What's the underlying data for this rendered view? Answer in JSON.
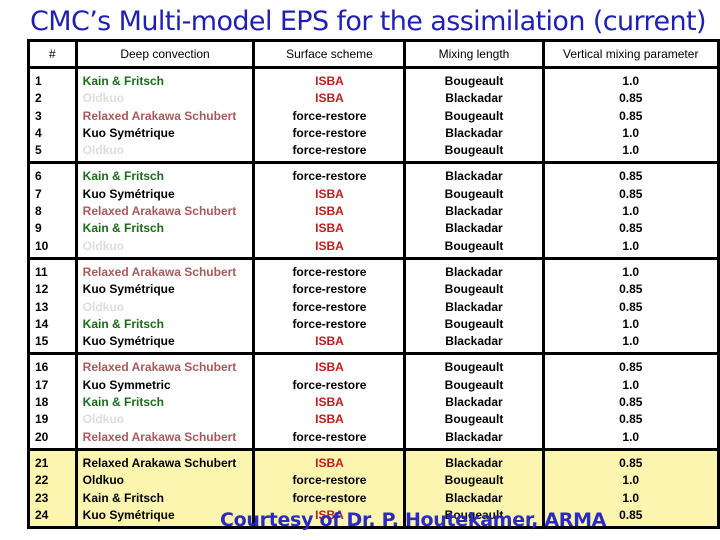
{
  "title": "CMC’s Multi-model EPS for the assimilation (current)",
  "table": {
    "headers": [
      "#",
      "Deep convection",
      "Surface scheme",
      "Mixing length",
      "Vertical mixing parameter"
    ],
    "groups": [
      {
        "highlight": false,
        "rows": [
          {
            "num": "1",
            "deep": " Kain & Fritsch",
            "deep_kind": "kain",
            "surface": "ISBA",
            "surface_kind": "isba",
            "mixing": "Bougeault",
            "vertical": "1.0"
          },
          {
            "num": "2",
            "deep": "Oldkuo",
            "deep_kind": "oldkuo",
            "surface": "ISBA",
            "surface_kind": "isba",
            "mixing": "Blackadar",
            "vertical": "0.85"
          },
          {
            "num": "3",
            "deep": "Relaxed Arakawa Schubert",
            "deep_kind": "ras",
            "surface": "force-restore",
            "surface_kind": "fr",
            "mixing": "Bougeault",
            "vertical": "0.85"
          },
          {
            "num": "4",
            "deep": "Kuo Symétrique",
            "deep_kind": "kuo",
            "surface": "force-restore",
            "surface_kind": "fr",
            "mixing": "Blackadar",
            "vertical": "1.0"
          },
          {
            "num": "5",
            "deep": "Oldkuo",
            "deep_kind": "oldkuo",
            "surface": "force-restore",
            "surface_kind": "fr",
            "mixing": "Bougeault",
            "vertical": "1.0"
          }
        ]
      },
      {
        "highlight": false,
        "rows": [
          {
            "num": "6",
            "deep": "Kain & Fritsch",
            "deep_kind": "kain",
            "surface": "force-restore",
            "surface_kind": "fr",
            "mixing": "Blackadar",
            "vertical": "0.85"
          },
          {
            "num": "7",
            "deep": "Kuo Symétrique",
            "deep_kind": "kuo",
            "surface": "ISBA",
            "surface_kind": "isba",
            "mixing": "Bougeault",
            "vertical": " 0.85"
          },
          {
            "num": "8",
            "deep": "Relaxed Arakawa Schubert",
            "deep_kind": "ras",
            "surface": "ISBA",
            "surface_kind": "isba",
            "mixing": "Blackadar",
            "vertical": "1.0"
          },
          {
            "num": "9",
            "deep": "Kain & Fritsch",
            "deep_kind": "kain",
            "surface": "ISBA",
            "surface_kind": "isba",
            "mixing": "Blackadar",
            "vertical": "0.85"
          },
          {
            "num": "10",
            "deep": "Oldkuo",
            "deep_kind": "oldkuo",
            "surface": "ISBA",
            "surface_kind": "isba",
            "mixing": "Bougeault",
            "vertical": "1.0"
          }
        ]
      },
      {
        "highlight": false,
        "rows": [
          {
            "num": "11",
            "deep": "Relaxed Arakawa Schubert",
            "deep_kind": "ras",
            "surface": "force-restore",
            "surface_kind": "fr",
            "mixing": "Blackadar",
            "vertical": "1.0"
          },
          {
            "num": "12",
            "deep": "Kuo Symétrique",
            "deep_kind": "kuo",
            "surface": "force-restore",
            "surface_kind": "fr",
            "mixing": "Bougeault",
            "vertical": "0.85"
          },
          {
            "num": "13",
            "deep": "Oldkuo",
            "deep_kind": "oldkuo",
            "surface": "force-restore",
            "surface_kind": "fr",
            "mixing": "Blackadar",
            "vertical": "0.85"
          },
          {
            "num": "14",
            "deep": "Kain & Fritsch",
            "deep_kind": "kain",
            "surface": "force-restore",
            "surface_kind": "fr",
            "mixing": "Bougeault",
            "vertical": "1.0"
          },
          {
            "num": "15",
            "deep": "Kuo Symétrique",
            "deep_kind": "kuo",
            "surface": "ISBA",
            "surface_kind": "isba",
            "mixing": "Blackadar",
            "vertical": "1.0"
          }
        ]
      },
      {
        "highlight": false,
        "rows": [
          {
            "num": "16",
            "deep": "Relaxed Arakawa Schubert",
            "deep_kind": "ras",
            "surface": "ISBA",
            "surface_kind": "isba",
            "mixing": "Bougeault",
            "vertical": "0.85"
          },
          {
            "num": "17",
            "deep": "Kuo Symmetric",
            "deep_kind": "kuo",
            "surface": "force-restore",
            "surface_kind": "fr",
            "mixing": "Bougeault",
            "vertical": "1.0"
          },
          {
            "num": "18",
            "deep": "Kain & Fritsch",
            "deep_kind": "kain",
            "surface": "ISBA",
            "surface_kind": "isba",
            "mixing": "Blackadar",
            "vertical": "0.85"
          },
          {
            "num": "19",
            "deep": "Oldkuo",
            "deep_kind": "oldkuo",
            "surface": "ISBA",
            "surface_kind": "isba",
            "mixing": "Bougeault",
            "vertical": "0.85"
          },
          {
            "num": "20",
            "deep": "Relaxed Arakawa Schubert",
            "deep_kind": "ras",
            "surface": "force-restore",
            "surface_kind": "fr",
            "mixing": "Blackadar",
            "vertical": "1.0"
          }
        ]
      },
      {
        "highlight": true,
        "rows": [
          {
            "num": "21",
            "deep": "Relaxed Arakawa Schubert",
            "deep_kind": "ras",
            "surface": "ISBA",
            "surface_kind": "isba",
            "mixing": "Blackadar",
            "vertical": "0.85"
          },
          {
            "num": "22",
            "deep": "Oldkuo",
            "deep_kind": "oldkuo",
            "surface": "force-restore",
            "surface_kind": "fr",
            "mixing": "Bougeault",
            "vertical": "1.0"
          },
          {
            "num": "23",
            "deep": "Kain & Fritsch",
            "deep_kind": "kain",
            "surface": "force-restore",
            "surface_kind": "fr",
            "mixing": "Blackadar",
            "vertical": "1.0"
          },
          {
            "num": "24",
            "deep": "Kuo Symétrique",
            "deep_kind": "kuo",
            "surface": "ISBA",
            "surface_kind": "isba",
            "mixing": "Bougeault",
            "vertical": "0.85"
          }
        ]
      }
    ]
  },
  "colors": {
    "title": "#1f1fb4",
    "kain_fritsch": "#1a6b1a",
    "oldkuo": "#e0ddd8",
    "relaxed_arakawa_schubert": "#a85a5a",
    "isba": "#c01c1c",
    "highlight_bg": "#fbf5b0",
    "courtesy": "#2b2bbf"
  },
  "courtesy": "Courtesy of Dr. P. Houtekamer, ARMA"
}
